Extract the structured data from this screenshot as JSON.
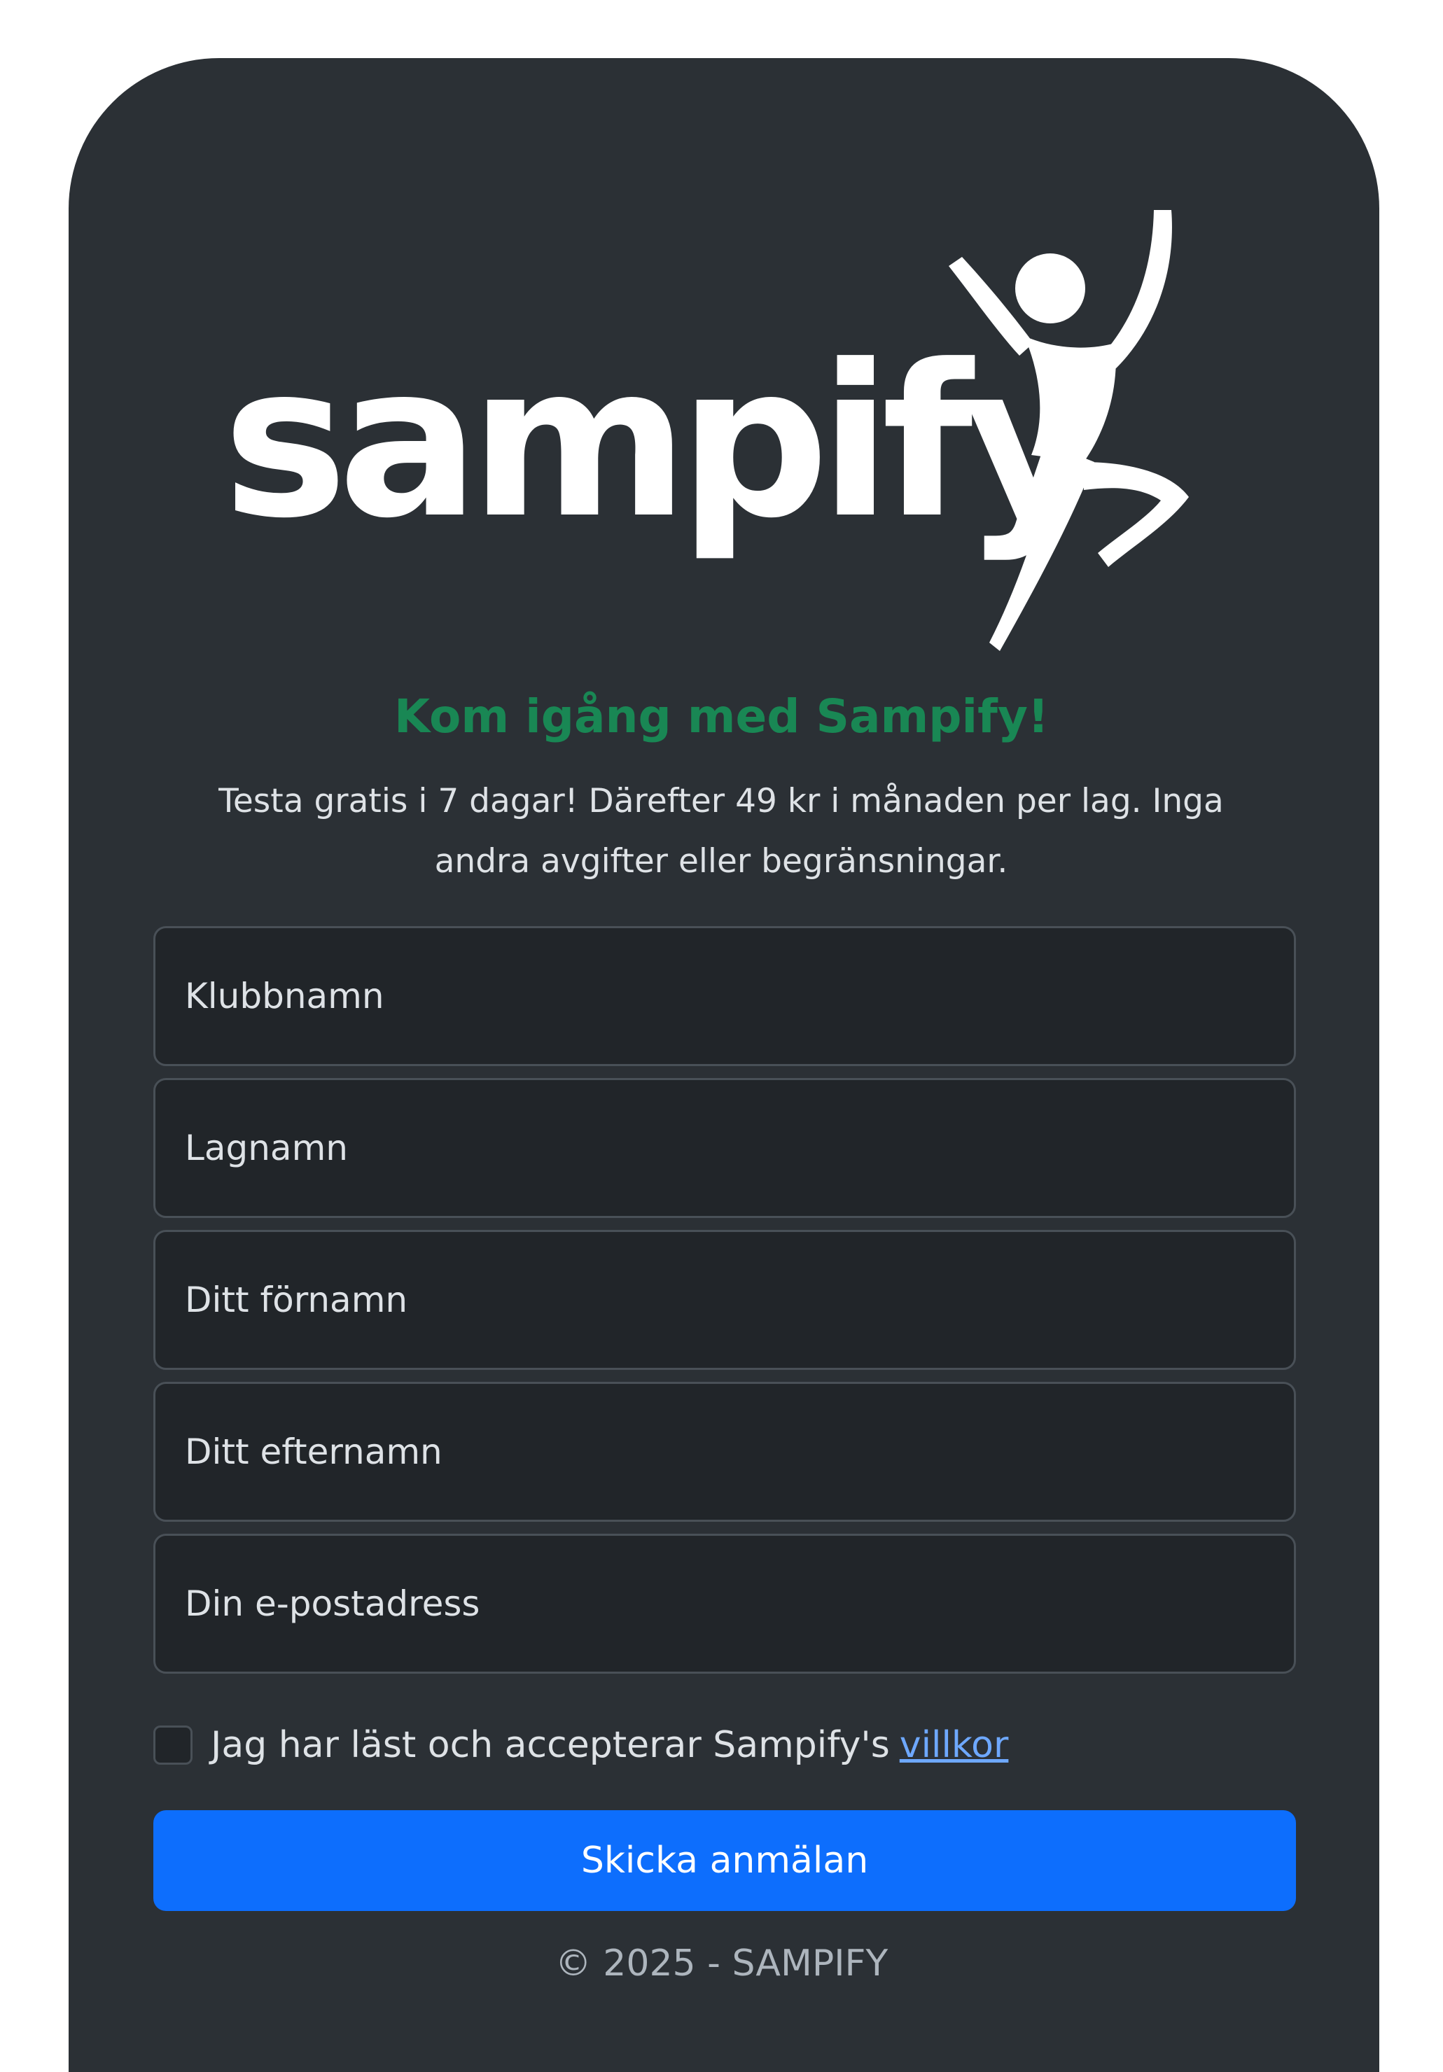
{
  "brand": {
    "logo_text": "sampify"
  },
  "signup": {
    "heading": "Kom igång med Sampify!",
    "description_line1": "Testa gratis i 7 dagar! Därefter 49 kr i månaden per lag. Inga",
    "description_line2": "andra avgifter eller begränsningar.",
    "fields": [
      {
        "placeholder": "Klubbnamn"
      },
      {
        "placeholder": "Lagnamn"
      },
      {
        "placeholder": "Ditt förnamn"
      },
      {
        "placeholder": "Ditt efternamn"
      },
      {
        "placeholder": "Din e-postadress"
      }
    ],
    "terms_text": "Jag har läst och accepterar Sampify's",
    "terms_link": "villkor",
    "submit_label": "Skicka anmälan"
  },
  "footer": {
    "copyright": "© 2025 - SAMPIFY"
  },
  "colors": {
    "card_background": "#2b3035",
    "heading": "#198754",
    "primary_button": "#0d6efd",
    "link": "#6ea8fe"
  }
}
